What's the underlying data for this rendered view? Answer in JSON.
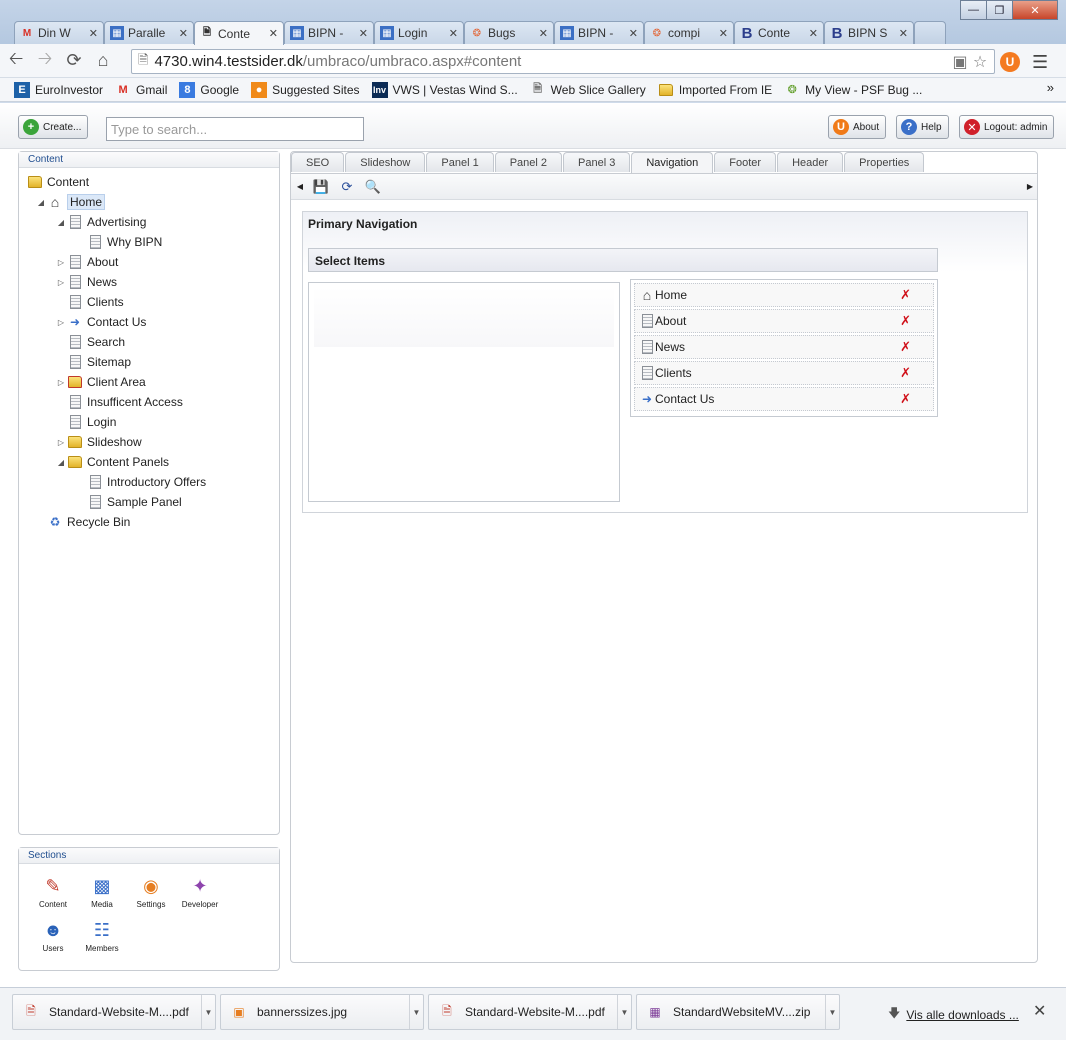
{
  "browser": {
    "tabs": [
      {
        "label": "Din W",
        "icon": "gmail-icon"
      },
      {
        "label": "Paralle",
        "icon": "site-icon"
      },
      {
        "label": "Conte",
        "icon": "page-icon",
        "active": true
      },
      {
        "label": "BIPN -",
        "icon": "site-icon"
      },
      {
        "label": "Login",
        "icon": "site-icon"
      },
      {
        "label": "Bugs",
        "icon": "bug-icon"
      },
      {
        "label": "BIPN -",
        "icon": "site-icon"
      },
      {
        "label": "compi",
        "icon": "bug-icon"
      },
      {
        "label": "Conte",
        "icon": "b-icon"
      },
      {
        "label": "BIPN S",
        "icon": "b-icon"
      }
    ],
    "url_host": "4730.win4.testsider.dk",
    "url_path": "/umbraco/umbraco.aspx#content",
    "bookmarks": [
      {
        "label": "EuroInvestor",
        "icon": "euroinvestor-icon"
      },
      {
        "label": "Gmail",
        "icon": "gmail-icon"
      },
      {
        "label": "Google",
        "icon": "google-icon"
      },
      {
        "label": "Suggested Sites",
        "icon": "suggested-icon"
      },
      {
        "label": "VWS | Vestas Wind S...",
        "icon": "inv-icon"
      },
      {
        "label": "Web Slice Gallery",
        "icon": "page-icon"
      },
      {
        "label": "Imported From IE",
        "icon": "folder-icon"
      },
      {
        "label": "My View - PSF Bug ...",
        "icon": "bug-icon"
      }
    ]
  },
  "topbar": {
    "create_label": "Create...",
    "search_placeholder": "Type to search...",
    "about_label": "About",
    "help_label": "Help",
    "logout_label": "Logout: admin"
  },
  "content_panel": {
    "header": "Content",
    "tree": {
      "root": "Content",
      "home": "Home",
      "items": [
        "Advertising",
        "Why BIPN",
        "About",
        "News",
        "Clients",
        "Contact Us",
        "Search",
        "Sitemap",
        "Client Area",
        "Insufficent Access",
        "Login",
        "Slideshow",
        "Content Panels",
        "Introductory Offers",
        "Sample Panel"
      ],
      "recycle": "Recycle Bin"
    }
  },
  "sections_panel": {
    "header": "Sections",
    "items": [
      "Content",
      "Media",
      "Settings",
      "Developer",
      "Users",
      "Members"
    ]
  },
  "editor": {
    "tabs": [
      "SEO",
      "Slideshow",
      "Panel 1",
      "Panel 2",
      "Panel 3",
      "Navigation",
      "Footer",
      "Header",
      "Properties"
    ],
    "active_tab": "Navigation",
    "property_title": "Primary Navigation",
    "select_header": "Select Items",
    "selected_items": [
      "Home",
      "About",
      "News",
      "Clients",
      "Contact Us"
    ]
  },
  "downloads": {
    "items": [
      "Standard-Website-M....pdf",
      "bannerssizes.jpg",
      "Standard-Website-M....pdf",
      "StandardWebsiteMV....zip"
    ],
    "show_all": "Vis alle downloads ..."
  }
}
